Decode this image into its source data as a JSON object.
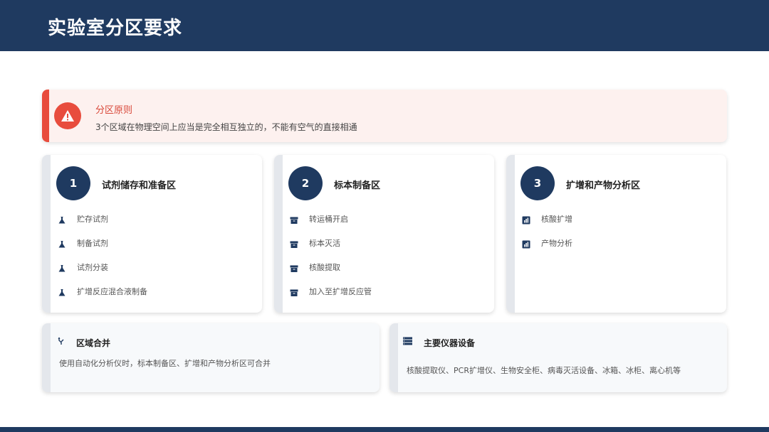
{
  "header": {
    "title": "实验室分区要求"
  },
  "alert": {
    "icon": "warning-icon",
    "title": "分区原则",
    "text": "3个区域在物理空间上应当是完全相互独立的，不能有空气的直接相通",
    "accent": "#e84c3d"
  },
  "zones": [
    {
      "number": "1",
      "title": "试剂储存和准备区",
      "icon": "flask-icon",
      "items": [
        "贮存试剂",
        "制备试剂",
        "试剂分装",
        "扩增反应混合液制备"
      ]
    },
    {
      "number": "2",
      "title": "标本制备区",
      "icon": "archive-box-icon",
      "items": [
        "转运桶开启",
        "标本灭活",
        "核酸提取",
        "加入至扩增反应管"
      ]
    },
    {
      "number": "3",
      "title": "扩增和产物分析区",
      "icon": "bar-chart-icon",
      "items": [
        "核酸扩增",
        "产物分析"
      ]
    }
  ],
  "merge": {
    "icon": "merge-icon",
    "title": "区域合并",
    "text": "使用自动化分析仪时，标本制备区、扩增和产物分析区可合并"
  },
  "equipment": {
    "icon": "list-icon",
    "title": "主要仪器设备",
    "text": "核酸提取仪、PCR扩增仪、生物安全柜、病毒灭活设备、冰箱、冰柜、离心机等"
  },
  "colors": {
    "navy": "#1f3a60",
    "red": "#e84c3d"
  }
}
